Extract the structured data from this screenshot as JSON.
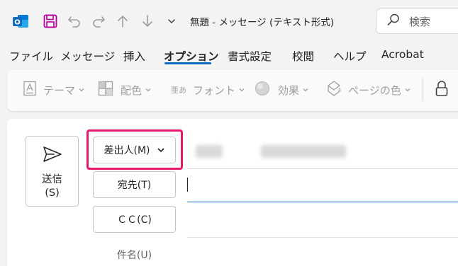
{
  "titlebar": {
    "title": "無題  -  メッセージ (テキスト形式)",
    "search_label": "検索",
    "outlook_badge": "O",
    "brand_color": "#0f6cbd",
    "save_icon_color": "#b4009e"
  },
  "menu": {
    "tabs": [
      {
        "label": "ファイル",
        "active": false
      },
      {
        "label": "メッセージ",
        "active": false
      },
      {
        "label": "挿入",
        "active": false
      },
      {
        "label": "オプション",
        "active": true
      },
      {
        "label": "書式設定",
        "active": false
      },
      {
        "label": "校閲",
        "active": false
      },
      {
        "label": "ヘルプ",
        "active": false
      },
      {
        "label": "Acrobat",
        "active": false
      }
    ]
  },
  "ribbon": {
    "theme": "テーマ",
    "colors": "配色",
    "font_icon_text": "亜あ",
    "font": "フォント",
    "effects": "効果",
    "page_color": "ページの色"
  },
  "compose": {
    "send_label_line1": "送信",
    "send_label_line2": "(S)",
    "from_label": "差出人(M)",
    "to_label": "宛先(T)",
    "cc_label": "ＣＣ(C)",
    "subject_label": "件名(U)",
    "highlight_color": "#e4186d"
  }
}
